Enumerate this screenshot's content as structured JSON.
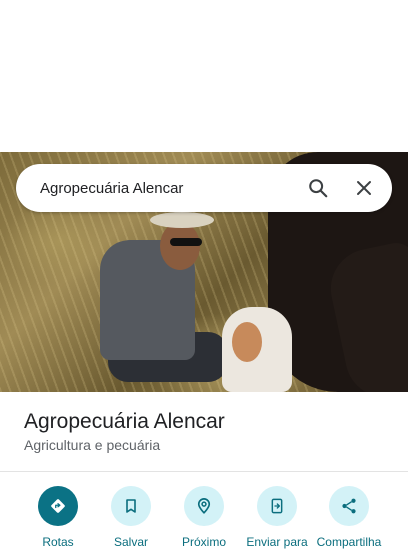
{
  "search": {
    "query": "Agropecuária Alencar"
  },
  "place": {
    "name": "Agropecuária Alencar",
    "category": "Agricultura e pecuária"
  },
  "actions": [
    {
      "label": "Rotas",
      "icon": "directions-icon"
    },
    {
      "label": "Salvar",
      "icon": "bookmark-icon"
    },
    {
      "label": "Próximo",
      "icon": "nearby-icon"
    },
    {
      "label": "Enviar para",
      "icon": "send-to-phone-icon"
    },
    {
      "label": "Compartilha",
      "icon": "share-icon"
    }
  ],
  "colors": {
    "accent": "#0b7285",
    "action_background": "#d3f2f7",
    "label": "#0b6e7e"
  }
}
